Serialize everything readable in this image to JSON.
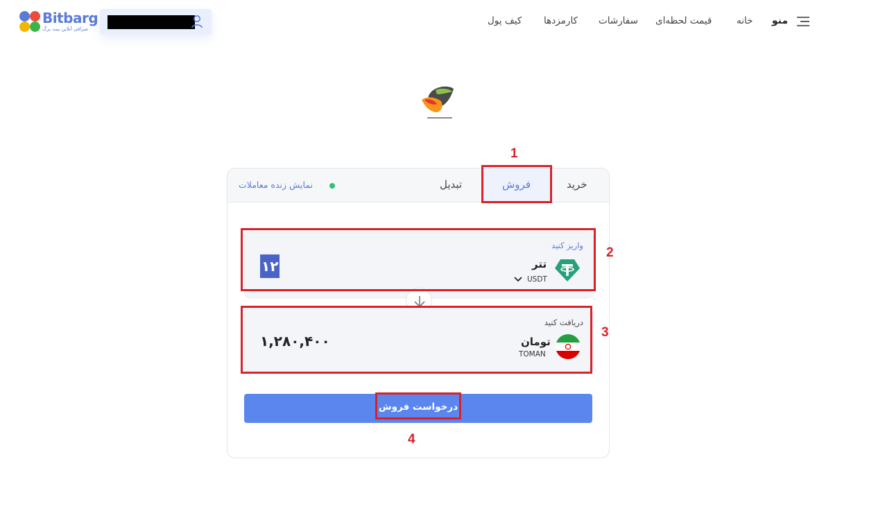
{
  "header": {
    "logo_word": "Bitbarg",
    "logo_subtitle": "صرافی آنلاین بیت برگ",
    "menu_label": "منو",
    "nav": [
      "خانه",
      "قیمت لحظه‌ای",
      "سفارشات",
      "کارمزدها",
      "کیف پول"
    ]
  },
  "tabs": {
    "buy": "خرید",
    "sell": "فروش",
    "convert": "تبدیل",
    "active": "sell",
    "live_trades": "نمایش زنده معاملات"
  },
  "deposit": {
    "label": "واریز کنید",
    "coin_name": "تتر",
    "coin_symbol": "USDT",
    "amount": "۱۲"
  },
  "receive": {
    "label": "دریافت کنید",
    "coin_name": "تومان",
    "coin_symbol": "TOMAN",
    "amount": "۱,۲۸۰,۴۰۰"
  },
  "submit_label": "درخواست فروش",
  "annotations": [
    "1",
    "2",
    "3",
    "4"
  ],
  "colors": {
    "accent": "#5a7bd8",
    "button": "#5a86ee",
    "annotation": "#d7222a",
    "live_dot": "#2fc07a",
    "tether": "#26a17b"
  }
}
